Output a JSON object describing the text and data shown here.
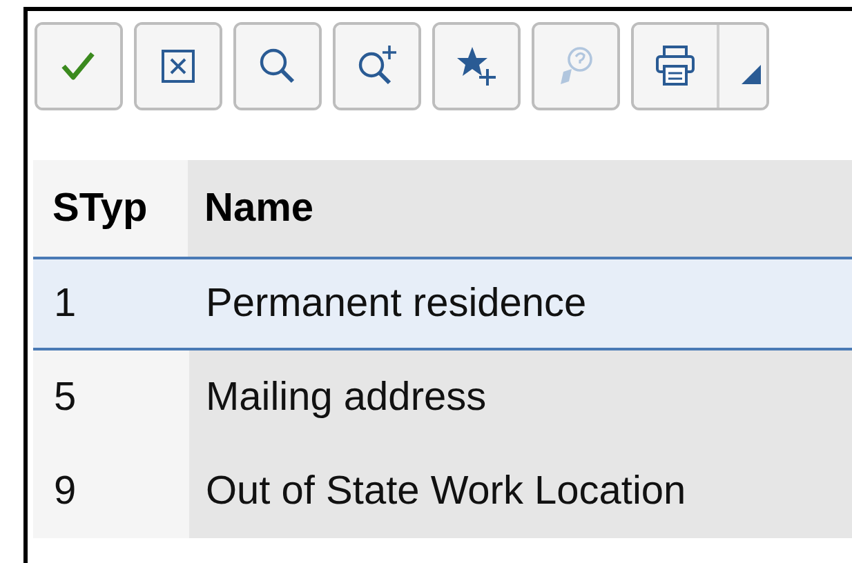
{
  "toolbar": [
    {
      "kind": "check",
      "disabled": false
    },
    {
      "kind": "cancel",
      "disabled": false
    },
    {
      "kind": "find",
      "disabled": false
    },
    {
      "kind": "find-next",
      "disabled": false
    },
    {
      "kind": "favorite-add",
      "disabled": false
    },
    {
      "kind": "help",
      "disabled": true
    },
    {
      "kind": "print",
      "disabled": false
    }
  ],
  "table": {
    "columns": [
      "STyp",
      "Name"
    ],
    "rows": [
      {
        "cells": [
          "1",
          "Permanent residence"
        ],
        "selected": true
      },
      {
        "cells": [
          "5",
          "Mailing address"
        ],
        "selected": false
      },
      {
        "cells": [
          "9",
          "Out of State Work Location"
        ],
        "selected": false
      }
    ]
  }
}
